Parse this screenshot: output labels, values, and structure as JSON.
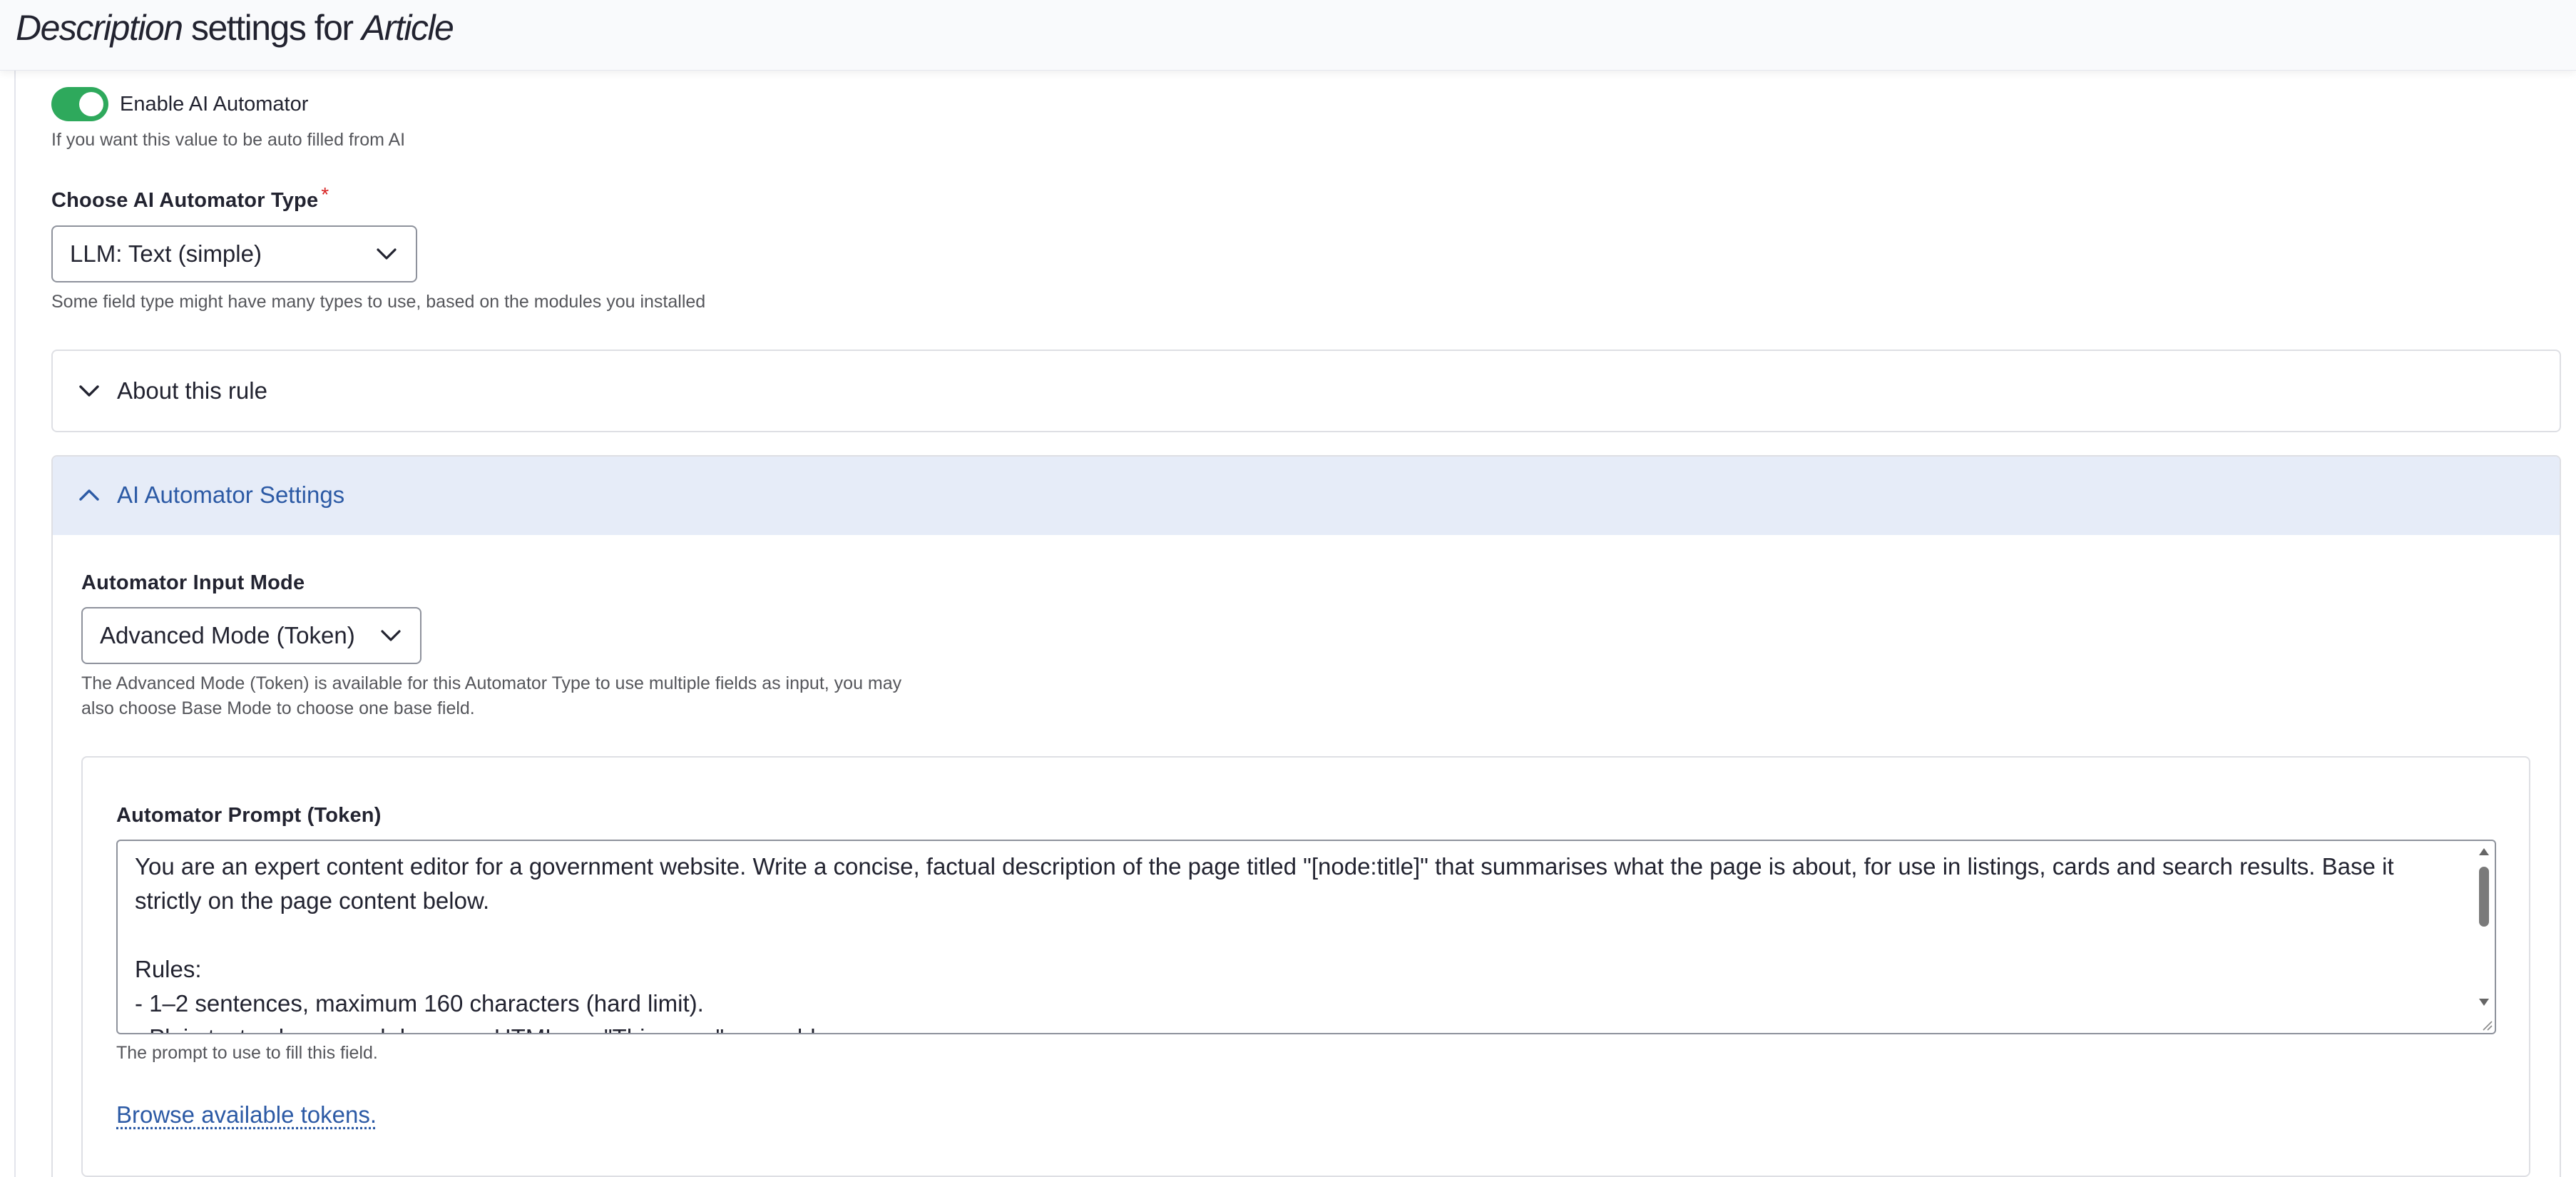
{
  "header": {
    "title_prefix": "Description",
    "title_middle": " settings for ",
    "title_entity": "Article"
  },
  "toggle": {
    "label": "Enable AI Automator",
    "enabled": true,
    "description": "If you want this value to be auto filled from AI"
  },
  "automator_type": {
    "label": "Choose AI Automator Type",
    "required_marker": "*",
    "value": "LLM: Text (simple)",
    "description": "Some field type might have many types to use, based on the modules you installed"
  },
  "about_rule": {
    "summary": "About this rule",
    "expanded": false
  },
  "ai_settings": {
    "summary": "AI Automator Settings",
    "expanded": true,
    "input_mode": {
      "label": "Automator Input Mode",
      "value": "Advanced Mode (Token)",
      "description_line1": "The Advanced Mode (Token) is available for this Automator Type to use multiple fields as input, you may",
      "description_line2": "also choose Base Mode to choose one base field."
    },
    "prompt": {
      "label": "Automator Prompt (Token)",
      "value": "You are an expert content editor for a government website. Write a concise, factual description of the page titled \"[node:title]\" that summarises what the page is about, for use in listings, cards and search results. Base it strictly on the page content below.\n\nRules:\n- 1–2 sentences, maximum 160 characters (hard limit).\n- Plain text only, no markdown, no HTML, no \"This page\" preamble.",
      "description": "The prompt to use to fill this field."
    },
    "tokens_link": "Browse available tokens."
  },
  "colors": {
    "accent_blue": "#2c5aa5",
    "toggle_green": "#2ea95c",
    "required_red": "#d72222",
    "expanded_bg": "#e6ecf8"
  }
}
